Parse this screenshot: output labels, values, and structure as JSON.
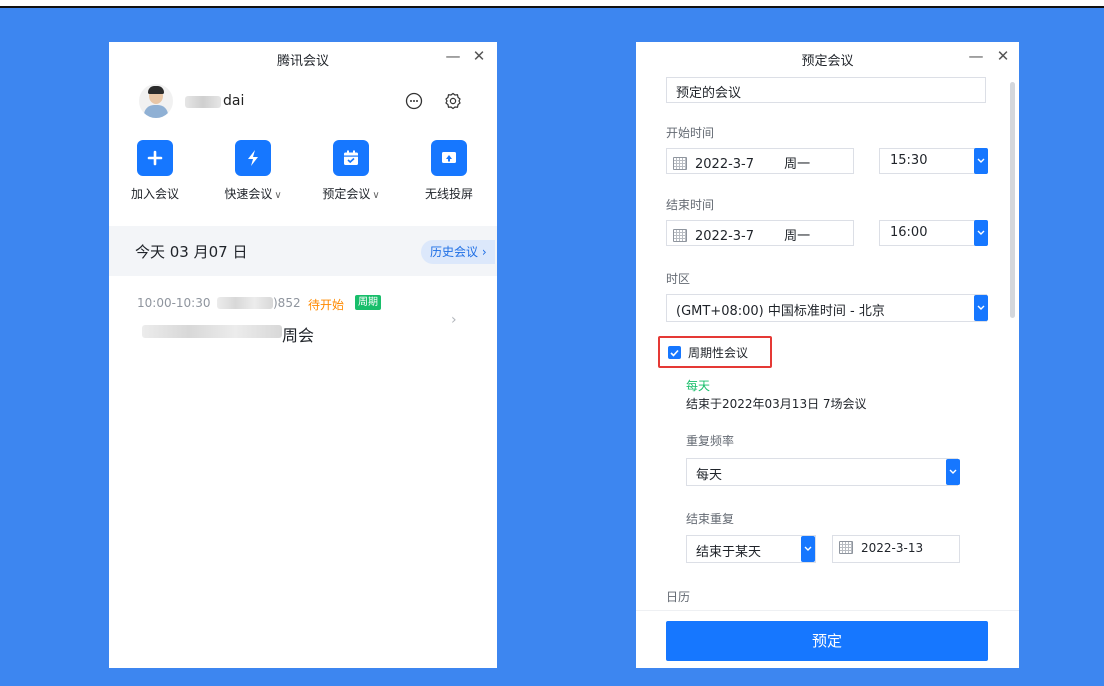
{
  "left_window": {
    "title": "腾讯会议",
    "minimize": "—",
    "close": "✕",
    "user": {
      "name": "dai"
    },
    "actions": [
      {
        "label": "加入会议",
        "caret": ""
      },
      {
        "label": "快速会议",
        "caret": "∨"
      },
      {
        "label": "预定会议",
        "caret": "∨"
      },
      {
        "label": "无线投屏",
        "caret": ""
      }
    ],
    "today_label": "今天 03 月07 日",
    "history_label": "历史会议 ›",
    "meeting": {
      "time": "10:00-10:30",
      "code_suffix": ")852",
      "status": "待开始",
      "badge": "周期",
      "name_suffix": "周会",
      "chevron": "›"
    }
  },
  "right_window": {
    "title": "预定会议",
    "minimize": "—",
    "close": "✕",
    "subject_value": "预定的会议",
    "start_label": "开始时间",
    "start_date": "2022-3-7",
    "start_weekday": "周一",
    "start_time": "15:30",
    "end_label": "结束时间",
    "end_date": "2022-3-7",
    "end_weekday": "周一",
    "end_time": "16:00",
    "timezone_label": "时区",
    "timezone_value": "(GMT+08:00) 中国标准时间 - 北京",
    "recurring_label": "周期性会议",
    "recurring_checked": true,
    "recurrence_summary_freq": "每天",
    "recurrence_summary_end": "结束于2022年03月13日 7场会议",
    "repeat_freq_label": "重复频率",
    "repeat_freq_value": "每天",
    "end_repeat_label": "结束重复",
    "end_repeat_mode": "结束于某天",
    "end_repeat_date": "2022-3-13",
    "calendar_label": "日历",
    "submit_label": "预定"
  },
  "colors": {
    "background": "#3d86f0",
    "accent": "#1677ff",
    "status_pending": "#ff8a00",
    "badge_green": "#19be6b",
    "highlight_red": "#e53935"
  }
}
